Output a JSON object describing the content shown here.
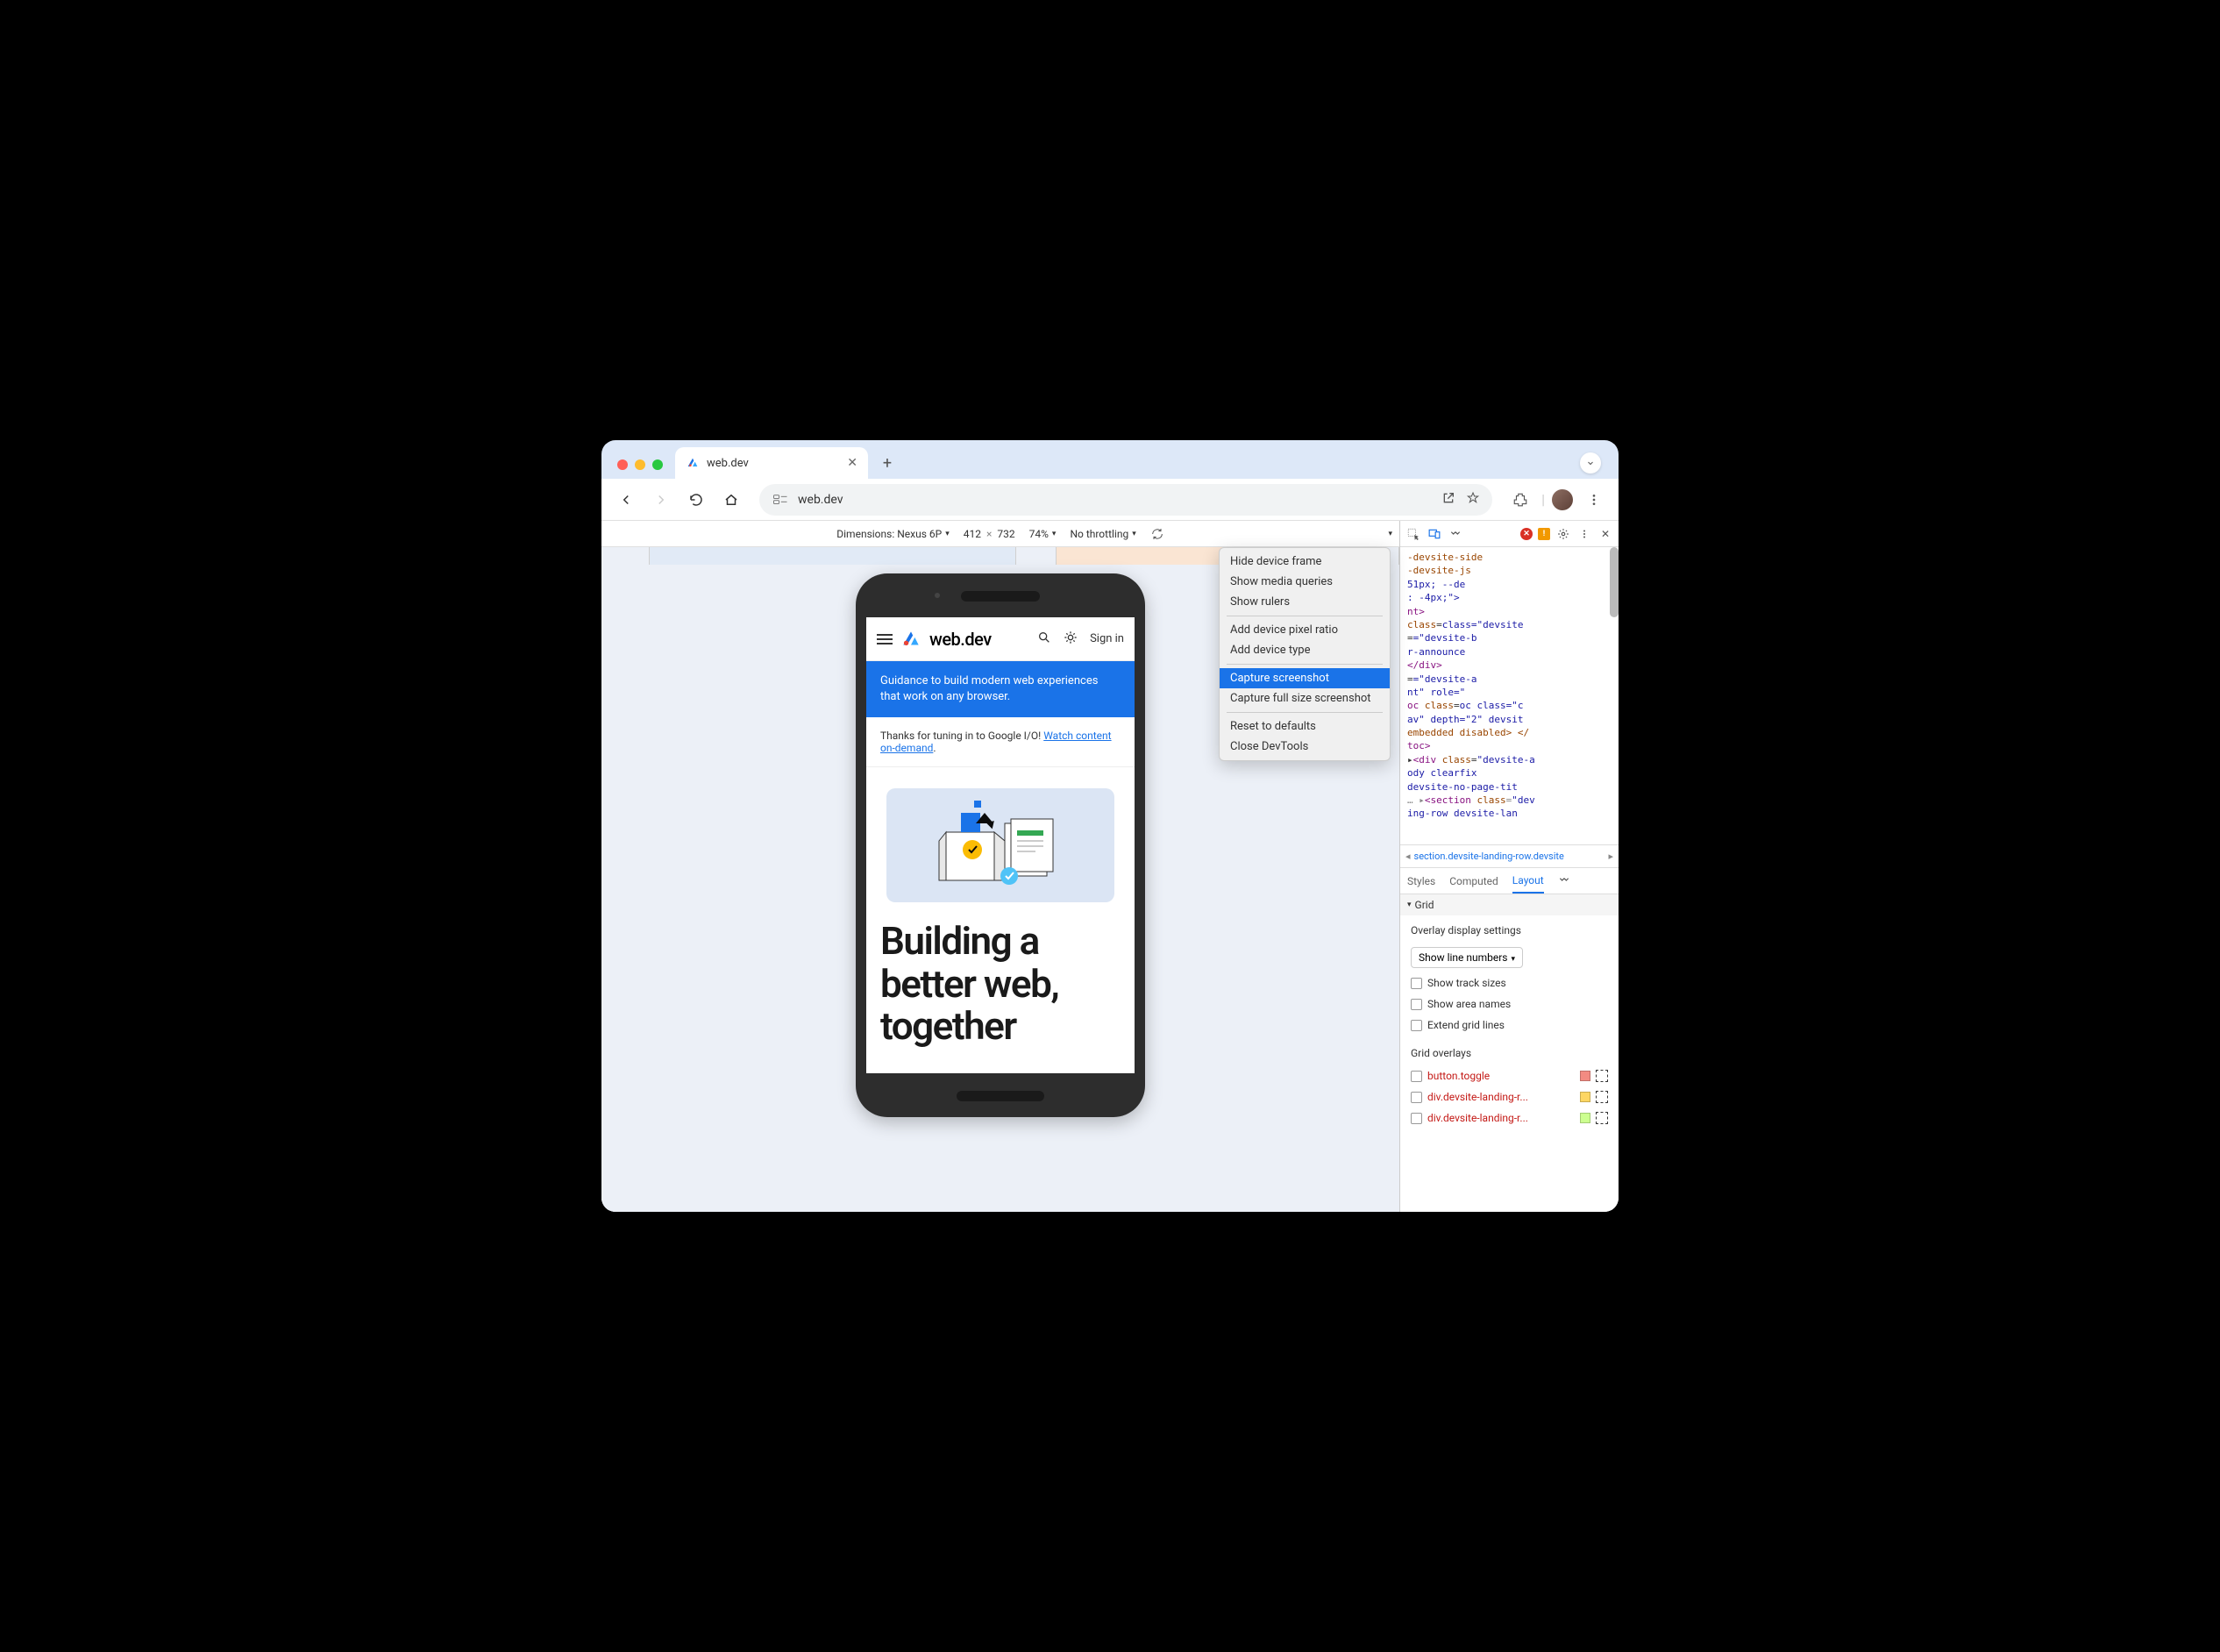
{
  "tab": {
    "title": "web.dev"
  },
  "address": {
    "url": "web.dev"
  },
  "deviceToolbar": {
    "dimensionsLabel": "Dimensions: Nexus 6P",
    "width": "412",
    "height": "732",
    "zoom": "74%",
    "throttling": "No throttling"
  },
  "site": {
    "brand": "web.dev",
    "signIn": "Sign in",
    "banner": "Guidance to build modern web experiences that work on any browser.",
    "noticePrefix": "Thanks for tuning in to Google I/O! ",
    "noticeLink": "Watch content on-demand",
    "noticeSuffix": ".",
    "heroTitle": "Building a better web, together"
  },
  "dropdown": {
    "hideFrame": "Hide device frame",
    "showMedia": "Show media queries",
    "showRulers": "Show rulers",
    "addPixelRatio": "Add device pixel ratio",
    "addDeviceType": "Add device type",
    "captureScreenshot": "Capture screenshot",
    "captureFull": "Capture full size screenshot",
    "reset": "Reset to defaults",
    "closeDevtools": "Close DevTools"
  },
  "devtools": {
    "breadcrumb": "section.devsite-landing-row.devsite",
    "tabs": {
      "styles": "Styles",
      "computed": "Computed",
      "layout": "Layout"
    },
    "gridHeader": "Grid",
    "overlayHeading": "Overlay display settings",
    "showLineNumbers": "Show line numbers",
    "checkboxes": {
      "trackSizes": "Show track sizes",
      "areaNames": "Show area names",
      "extendLines": "Extend grid lines"
    },
    "gridOverlaysHeading": "Grid overlays",
    "overlays": [
      {
        "label": "button.toggle",
        "color": "#f28b82"
      },
      {
        "label": "div.devsite-landing-r...",
        "color": "#fdd663"
      },
      {
        "label": "div.devsite-landing-r...",
        "color": "#ccff90"
      }
    ],
    "elements": {
      "l1": "-devsite-side",
      "l2": "-devsite-js",
      "l3": "51px; --de",
      "l4": ": -4px;\">",
      "l5": "nt>",
      "l6": "class=\"devsite",
      "l7": "=\"devsite-b",
      "l8": "r-announce",
      "l9": "</div>",
      "l10": "=\"devsite-a",
      "l11": "nt\" role=\"",
      "l12": "oc class=\"c",
      "l13": "av\" depth=\"2\" devsit",
      "l14": "embedded disabled> </",
      "l15": "toc>",
      "l16": "<div class=\"devsite-a",
      "l17": "ody clearfix",
      "l18": "devsite-no-page-tit",
      "l19": "<section class=\"dev",
      "l20": "ing-row devsite-lan"
    }
  }
}
